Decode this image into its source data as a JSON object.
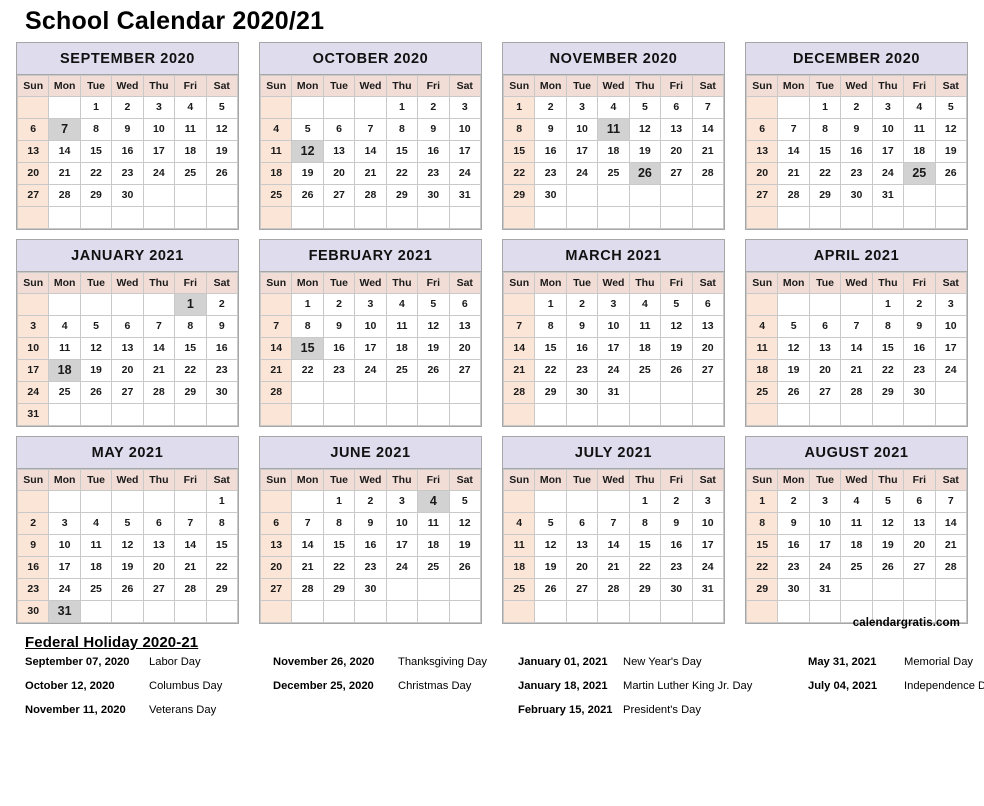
{
  "page_title": "School Calendar 2020/21",
  "watermark": "calendargratis.com",
  "weekdays": [
    "Sun",
    "Mon",
    "Tue",
    "Wed",
    "Thu",
    "Fri",
    "Sat"
  ],
  "colors": {
    "month_header_bg": "#dedced",
    "weekday_header_bg": "#f1ddd6",
    "sunday_bg": "#fbe5d6",
    "holiday_bg": "#d2d2d2",
    "grid_border": "#c9c9c9",
    "panel_border": "#a6a6a6"
  },
  "months": [
    {
      "title": "SEPTEMBER 2020",
      "weeks": [
        [
          "",
          "",
          "1",
          "2",
          "3",
          "4",
          "5"
        ],
        [
          "6",
          "7",
          "8",
          "9",
          "10",
          "11",
          "12"
        ],
        [
          "13",
          "14",
          "15",
          "16",
          "17",
          "18",
          "19"
        ],
        [
          "20",
          "21",
          "22",
          "23",
          "24",
          "25",
          "26"
        ],
        [
          "27",
          "28",
          "29",
          "30",
          "",
          "",
          ""
        ],
        [
          "",
          "",
          "",
          "",
          "",
          "",
          ""
        ]
      ],
      "holidays": [
        "7"
      ]
    },
    {
      "title": "OCTOBER 2020",
      "weeks": [
        [
          "",
          "",
          "",
          "",
          "1",
          "2",
          "3"
        ],
        [
          "4",
          "5",
          "6",
          "7",
          "8",
          "9",
          "10"
        ],
        [
          "11",
          "12",
          "13",
          "14",
          "15",
          "16",
          "17"
        ],
        [
          "18",
          "19",
          "20",
          "21",
          "22",
          "23",
          "24"
        ],
        [
          "25",
          "26",
          "27",
          "28",
          "29",
          "30",
          "31"
        ],
        [
          "",
          "",
          "",
          "",
          "",
          "",
          ""
        ]
      ],
      "holidays": [
        "12"
      ]
    },
    {
      "title": "NOVEMBER 2020",
      "weeks": [
        [
          "1",
          "2",
          "3",
          "4",
          "5",
          "6",
          "7"
        ],
        [
          "8",
          "9",
          "10",
          "11",
          "12",
          "13",
          "14"
        ],
        [
          "15",
          "16",
          "17",
          "18",
          "19",
          "20",
          "21"
        ],
        [
          "22",
          "23",
          "24",
          "25",
          "26",
          "27",
          "28"
        ],
        [
          "29",
          "30",
          "",
          "",
          "",
          "",
          ""
        ],
        [
          "",
          "",
          "",
          "",
          "",
          "",
          ""
        ]
      ],
      "holidays": [
        "11",
        "26"
      ]
    },
    {
      "title": "DECEMBER 2020",
      "weeks": [
        [
          "",
          "",
          "1",
          "2",
          "3",
          "4",
          "5"
        ],
        [
          "6",
          "7",
          "8",
          "9",
          "10",
          "11",
          "12"
        ],
        [
          "13",
          "14",
          "15",
          "16",
          "17",
          "18",
          "19"
        ],
        [
          "20",
          "21",
          "22",
          "23",
          "24",
          "25",
          "26"
        ],
        [
          "27",
          "28",
          "29",
          "30",
          "31",
          "",
          ""
        ],
        [
          "",
          "",
          "",
          "",
          "",
          "",
          ""
        ]
      ],
      "holidays": [
        "25"
      ]
    },
    {
      "title": "JANUARY 2021",
      "weeks": [
        [
          "",
          "",
          "",
          "",
          "",
          "1",
          "2"
        ],
        [
          "3",
          "4",
          "5",
          "6",
          "7",
          "8",
          "9"
        ],
        [
          "10",
          "11",
          "12",
          "13",
          "14",
          "15",
          "16"
        ],
        [
          "17",
          "18",
          "19",
          "20",
          "21",
          "22",
          "23"
        ],
        [
          "24",
          "25",
          "26",
          "27",
          "28",
          "29",
          "30"
        ],
        [
          "31",
          "",
          "",
          "",
          "",
          "",
          ""
        ]
      ],
      "holidays": [
        "1",
        "18"
      ]
    },
    {
      "title": "FEBRUARY 2021",
      "weeks": [
        [
          "",
          "1",
          "2",
          "3",
          "4",
          "5",
          "6"
        ],
        [
          "7",
          "8",
          "9",
          "10",
          "11",
          "12",
          "13"
        ],
        [
          "14",
          "15",
          "16",
          "17",
          "18",
          "19",
          "20"
        ],
        [
          "21",
          "22",
          "23",
          "24",
          "25",
          "26",
          "27"
        ],
        [
          "28",
          "",
          "",
          "",
          "",
          "",
          ""
        ],
        [
          "",
          "",
          "",
          "",
          "",
          "",
          ""
        ]
      ],
      "holidays": [
        "15"
      ]
    },
    {
      "title": "MARCH 2021",
      "weeks": [
        [
          "",
          "1",
          "2",
          "3",
          "4",
          "5",
          "6"
        ],
        [
          "7",
          "8",
          "9",
          "10",
          "11",
          "12",
          "13"
        ],
        [
          "14",
          "15",
          "16",
          "17",
          "18",
          "19",
          "20"
        ],
        [
          "21",
          "22",
          "23",
          "24",
          "25",
          "26",
          "27"
        ],
        [
          "28",
          "29",
          "30",
          "31",
          "",
          "",
          ""
        ],
        [
          "",
          "",
          "",
          "",
          "",
          "",
          ""
        ]
      ],
      "holidays": []
    },
    {
      "title": "APRIL 2021",
      "weeks": [
        [
          "",
          "",
          "",
          "",
          "1",
          "2",
          "3"
        ],
        [
          "4",
          "5",
          "6",
          "7",
          "8",
          "9",
          "10"
        ],
        [
          "11",
          "12",
          "13",
          "14",
          "15",
          "16",
          "17"
        ],
        [
          "18",
          "19",
          "20",
          "21",
          "22",
          "23",
          "24"
        ],
        [
          "25",
          "26",
          "27",
          "28",
          "29",
          "30",
          ""
        ],
        [
          "",
          "",
          "",
          "",
          "",
          "",
          ""
        ]
      ],
      "holidays": []
    },
    {
      "title": "MAY 2021",
      "weeks": [
        [
          "",
          "",
          "",
          "",
          "",
          "",
          "1"
        ],
        [
          "2",
          "3",
          "4",
          "5",
          "6",
          "7",
          "8"
        ],
        [
          "9",
          "10",
          "11",
          "12",
          "13",
          "14",
          "15"
        ],
        [
          "16",
          "17",
          "18",
          "19",
          "20",
          "21",
          "22"
        ],
        [
          "23",
          "24",
          "25",
          "26",
          "27",
          "28",
          "29"
        ],
        [
          "30",
          "31",
          "",
          "",
          "",
          "",
          ""
        ]
      ],
      "holidays": [
        "31"
      ]
    },
    {
      "title": "JUNE 2021",
      "weeks": [
        [
          "",
          "",
          "1",
          "2",
          "3",
          "4",
          "5"
        ],
        [
          "6",
          "7",
          "8",
          "9",
          "10",
          "11",
          "12"
        ],
        [
          "13",
          "14",
          "15",
          "16",
          "17",
          "18",
          "19"
        ],
        [
          "20",
          "21",
          "22",
          "23",
          "24",
          "25",
          "26"
        ],
        [
          "27",
          "28",
          "29",
          "30",
          "",
          "",
          ""
        ],
        [
          "",
          "",
          "",
          "",
          "",
          "",
          ""
        ]
      ],
      "holidays": [
        "4"
      ]
    },
    {
      "title": "JULY 2021",
      "weeks": [
        [
          "",
          "",
          "",
          "",
          "1",
          "2",
          "3"
        ],
        [
          "4",
          "5",
          "6",
          "7",
          "8",
          "9",
          "10"
        ],
        [
          "11",
          "12",
          "13",
          "14",
          "15",
          "16",
          "17"
        ],
        [
          "18",
          "19",
          "20",
          "21",
          "22",
          "23",
          "24"
        ],
        [
          "25",
          "26",
          "27",
          "28",
          "29",
          "30",
          "31"
        ],
        [
          "",
          "",
          "",
          "",
          "",
          "",
          ""
        ]
      ],
      "holidays": []
    },
    {
      "title": "AUGUST 2021",
      "weeks": [
        [
          "1",
          "2",
          "3",
          "4",
          "5",
          "6",
          "7"
        ],
        [
          "8",
          "9",
          "10",
          "11",
          "12",
          "13",
          "14"
        ],
        [
          "15",
          "16",
          "17",
          "18",
          "19",
          "20",
          "21"
        ],
        [
          "22",
          "23",
          "24",
          "25",
          "26",
          "27",
          "28"
        ],
        [
          "29",
          "30",
          "31",
          "",
          "",
          "",
          ""
        ],
        [
          "",
          "",
          "",
          "",
          "",
          "",
          ""
        ]
      ],
      "holidays": []
    }
  ],
  "federal_holidays": {
    "title": "Federal Holiday 2020-21",
    "columns": [
      [
        {
          "date": "September 07, 2020",
          "name": "Labor Day"
        },
        {
          "date": "October 12, 2020",
          "name": "Columbus Day"
        },
        {
          "date": "November 11, 2020",
          "name": "Veterans Day"
        }
      ],
      [
        {
          "date": "November 26, 2020",
          "name": "Thanksgiving Day"
        },
        {
          "date": "December 25, 2020",
          "name": "Christmas Day"
        }
      ],
      [
        {
          "date": "January 01, 2021",
          "name": "New Year's Day"
        },
        {
          "date": "January 18, 2021",
          "name": "Martin Luther King Jr. Day"
        },
        {
          "date": "February 15, 2021",
          "name": "President's Day"
        }
      ],
      [
        {
          "date": "May 31, 2021",
          "name": "Memorial Day"
        },
        {
          "date": "July 04, 2021",
          "name": "Independence Day"
        }
      ]
    ]
  }
}
